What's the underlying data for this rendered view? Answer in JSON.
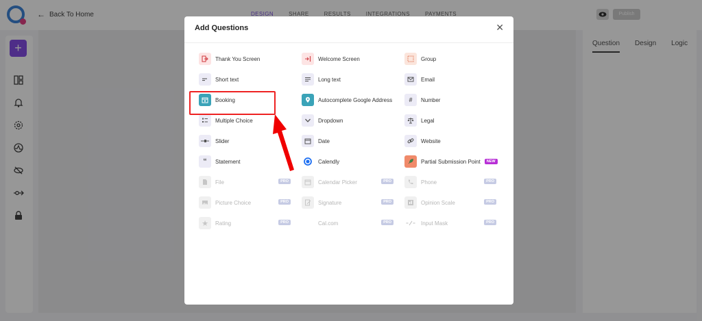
{
  "topbar": {
    "back_label": "Back To Home",
    "nav": [
      "DESIGN",
      "SHARE",
      "RESULTS",
      "INTEGRATIONS",
      "PAYMENTS"
    ],
    "active_nav": "DESIGN",
    "publish_label": "Publish"
  },
  "sidebar": {
    "icons": [
      "plus-icon",
      "layout-icon",
      "bell-icon",
      "gear-icon",
      "gauge-icon",
      "eye-off-icon",
      "logic-icon",
      "lock-icon"
    ]
  },
  "right_panel": {
    "tabs": [
      "Question",
      "Design",
      "Logic"
    ]
  },
  "modal": {
    "title": "Add Questions",
    "close_label": "✕",
    "items": [
      {
        "label": "Thank You Screen",
        "icon": "exit-icon"
      },
      {
        "label": "Welcome Screen",
        "icon": "enter-icon"
      },
      {
        "label": "Group",
        "icon": "group-icon"
      },
      {
        "label": "Short text",
        "icon": "short-text-icon"
      },
      {
        "label": "Long text",
        "icon": "long-text-icon"
      },
      {
        "label": "Email",
        "icon": "email-icon"
      },
      {
        "label": "Booking",
        "icon": "calendar-icon"
      },
      {
        "label": "Autocomplete Google Address",
        "icon": "map-pin-icon"
      },
      {
        "label": "Number",
        "icon": "hash-icon"
      },
      {
        "label": "Multiple Choice",
        "icon": "list-icon"
      },
      {
        "label": "Dropdown",
        "icon": "chevron-down-icon"
      },
      {
        "label": "Legal",
        "icon": "scale-icon"
      },
      {
        "label": "Slider",
        "icon": "slider-icon"
      },
      {
        "label": "Date",
        "icon": "date-icon"
      },
      {
        "label": "Website",
        "icon": "link-icon"
      },
      {
        "label": "Statement",
        "icon": "quote-icon"
      },
      {
        "label": "Calendly",
        "icon": "calendly-icon"
      },
      {
        "label": "Partial Submission Point",
        "icon": "rocket-icon",
        "badge": "NEW"
      },
      {
        "label": "File",
        "icon": "file-icon",
        "badge": "PRO"
      },
      {
        "label": "Calendar Picker",
        "icon": "calendar-picker-icon",
        "badge": "PRO"
      },
      {
        "label": "Phone",
        "icon": "phone-icon",
        "badge": "PRO"
      },
      {
        "label": "Picture Choice",
        "icon": "picture-icon",
        "badge": "PRO"
      },
      {
        "label": "Signature",
        "icon": "signature-icon",
        "badge": "PRO"
      },
      {
        "label": "Opinion Scale",
        "icon": "opinion-icon",
        "badge": "PRO"
      },
      {
        "label": "Rating",
        "icon": "star-icon",
        "badge": "PRO"
      },
      {
        "label": "Cal.com",
        "icon": "none",
        "badge": "PRO"
      },
      {
        "label": "Input Mask",
        "icon": "mask-icon",
        "badge": "PRO"
      }
    ]
  },
  "colors": {
    "accent": "#7b3fe4",
    "highlight": "#ee2121",
    "pro_badge": "#c6cbe4",
    "new_badge": "#b72fd6"
  }
}
